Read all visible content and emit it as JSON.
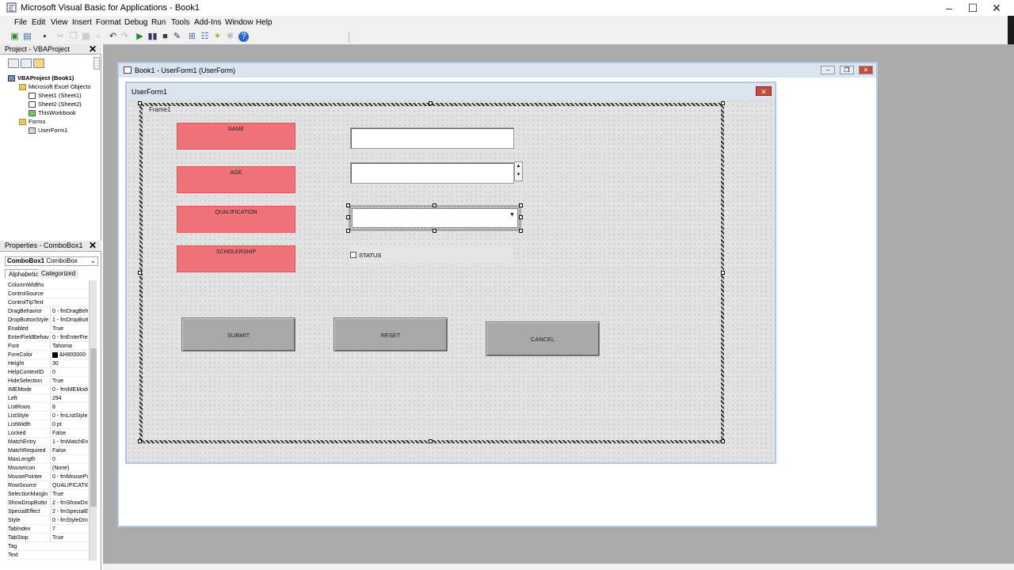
{
  "app": {
    "title": "Microsoft Visual Basic for Applications - Book1"
  },
  "menu": [
    "File",
    "Edit",
    "View",
    "Insert",
    "Format",
    "Debug",
    "Run",
    "Tools",
    "Add-Ins",
    "Window",
    "Help"
  ],
  "project_panel": {
    "title": "Project - VBAProject",
    "tree": {
      "root": "VBAProject (Book1)",
      "excel_objects": "Microsoft Excel Objects",
      "sheet1": "Sheet1 (Sheet1)",
      "sheet2": "Sheet2 (Sheet2)",
      "this_workbook": "ThisWorkbook",
      "forms": "Forms",
      "userform1": "UserForm1"
    }
  },
  "properties_panel": {
    "title": "Properties - ComboBox1",
    "object_name": "ComboBox1",
    "object_type": "ComboBox",
    "tabs": [
      "Alphabetic",
      "Categorized"
    ],
    "rows": [
      [
        "ColumnWidths",
        ""
      ],
      [
        "ControlSource",
        ""
      ],
      [
        "ControlTipText",
        ""
      ],
      [
        "DragBehavior",
        "0 - fmDragBeh"
      ],
      [
        "DropButtonStyle",
        "1 - fmDropButt"
      ],
      [
        "Enabled",
        "True"
      ],
      [
        "EnterFieldBehav",
        "0 - fmEnterFiel"
      ],
      [
        "Font",
        "Tahoma"
      ],
      [
        "ForeColor",
        "&H800000"
      ],
      [
        "Height",
        "30"
      ],
      [
        "HelpContextID",
        "0"
      ],
      [
        "HideSelection",
        "True"
      ],
      [
        "IMEMode",
        "0 - fmIMEMode"
      ],
      [
        "Left",
        "294"
      ],
      [
        "ListRows",
        "8"
      ],
      [
        "ListStyle",
        "0 - fmListStyle"
      ],
      [
        "ListWidth",
        "0 pt"
      ],
      [
        "Locked",
        "False"
      ],
      [
        "MatchEntry",
        "1 - fmMatchEn"
      ],
      [
        "MatchRequired",
        "False"
      ],
      [
        "MaxLength",
        "0"
      ],
      [
        "MouseIcon",
        "(None)"
      ],
      [
        "MousePointer",
        "0 - fmMousePo"
      ],
      [
        "RowSource",
        "QUALIFICATIO"
      ],
      [
        "SelectionMargin",
        "True"
      ],
      [
        "ShowDropButto",
        "2 - fmShowDro"
      ],
      [
        "SpecialEffect",
        "2 - fmSpecialE"
      ],
      [
        "Style",
        "0 - fmStyleDro"
      ],
      [
        "TabIndex",
        "7"
      ],
      [
        "TabStop",
        "True"
      ],
      [
        "Tag",
        ""
      ],
      [
        "Text",
        ""
      ]
    ]
  },
  "code_window": {
    "title": "Book1 - UserForm1 (UserForm)"
  },
  "userform": {
    "title": "UserForm1",
    "frame_caption": "Frame1",
    "labels": {
      "name": "NAME",
      "age": "AGE",
      "qualification": "QUALIFICATION",
      "scholership": "SCHOLERSHIP"
    },
    "status_label": "STATUS",
    "buttons": {
      "submit": "SUBMIT",
      "reset": "RESET",
      "cancel": "CANCEL"
    }
  },
  "colors": {
    "label_fill": "#f07379",
    "button_fill": "#a9a9a9",
    "mdi_background": "#ababab"
  }
}
